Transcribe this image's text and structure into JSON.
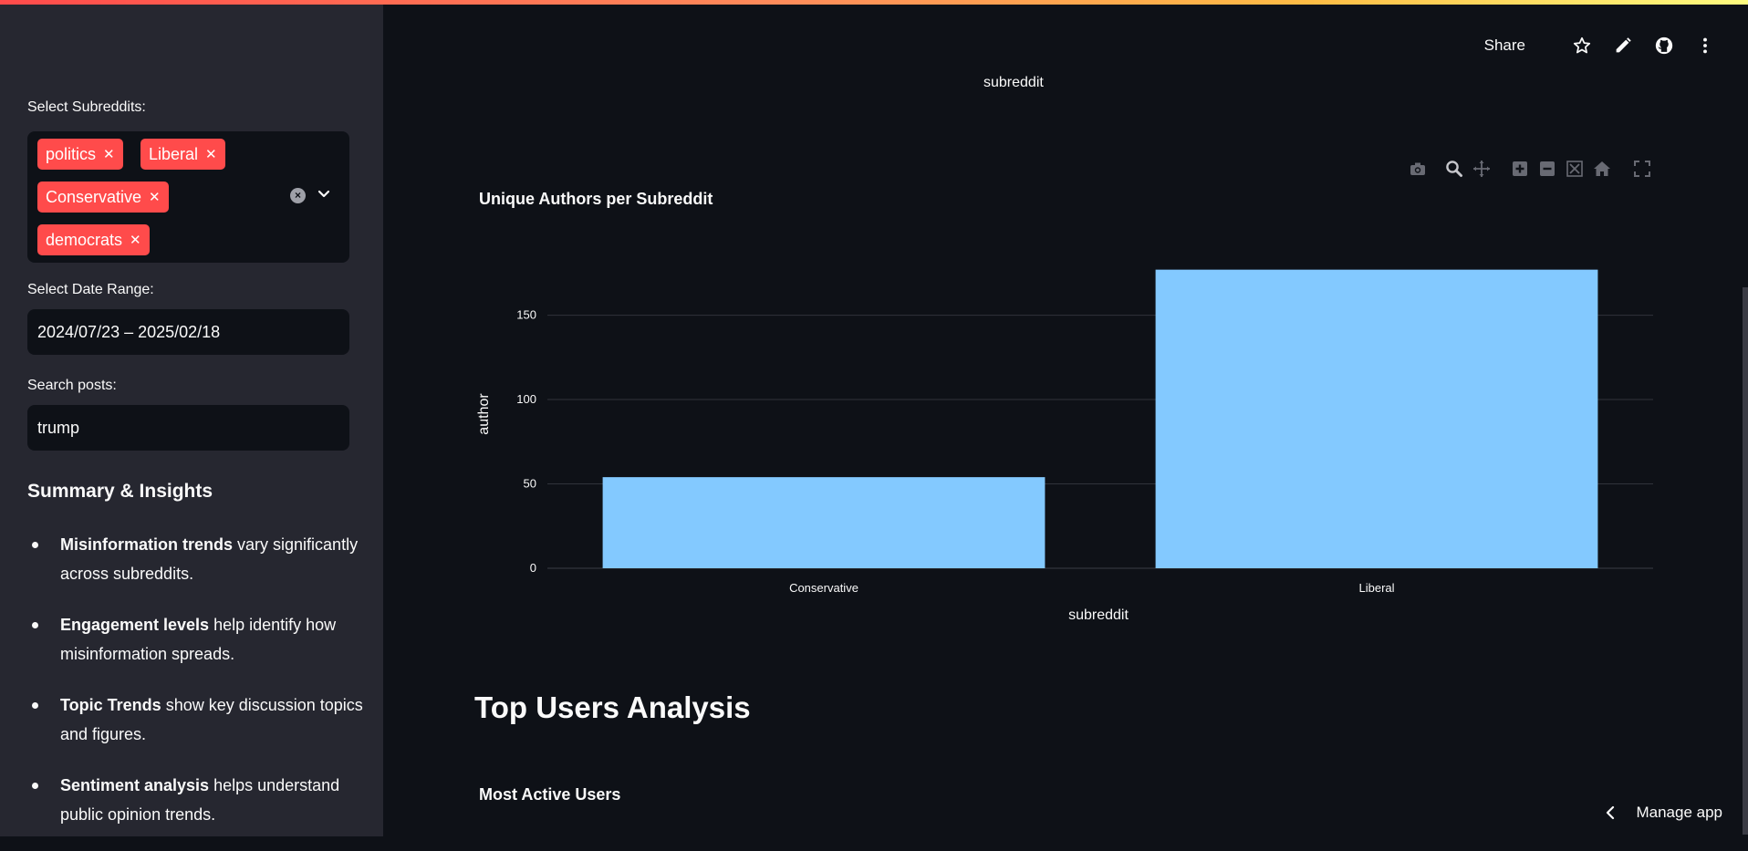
{
  "sidebar": {
    "subreddits_label": "Select Subreddits:",
    "chips": [
      {
        "label": "politics"
      },
      {
        "label": "Liberal"
      },
      {
        "label": "Conservative"
      },
      {
        "label": "democrats"
      }
    ],
    "chip_remove_glyph": "✕",
    "date_label": "Select Date Range:",
    "date_value": "2024/07/23 – 2025/02/18",
    "search_label": "Search posts:",
    "search_value": "trump",
    "summary_heading": "Summary & Insights",
    "insights": [
      {
        "bold": "Misinformation trends",
        "rest": " vary significantly across subreddits."
      },
      {
        "bold": "Engagement levels",
        "rest": " help identify how misinformation spreads."
      },
      {
        "bold": "Topic Trends",
        "rest": " show key discussion topics and figures."
      },
      {
        "bold": "Sentiment analysis",
        "rest": " helps understand public opinion trends."
      }
    ]
  },
  "header": {
    "share_label": "Share",
    "icons": [
      "star-icon",
      "pencil-icon",
      "github-icon",
      "more-vert-icon"
    ]
  },
  "main": {
    "prev_chart_axis_label": "subreddit",
    "modebar_icons": [
      "camera-icon",
      "zoom-icon",
      "pan-icon",
      "zoom-in-icon",
      "zoom-out-icon",
      "autoscale-icon",
      "reset-axes-icon",
      "fullscreen-icon"
    ],
    "chart_title": "Unique Authors per Subreddit",
    "section_heading": "Top Users Analysis",
    "sub_heading": "Most Active Users",
    "manage_app_label": "Manage app"
  },
  "colors": {
    "accent": "#ff4b4b",
    "bar": "#83c9ff",
    "background": "#0e1117",
    "sidebar": "#262730"
  },
  "chart_data": {
    "type": "bar",
    "title": "Unique Authors per Subreddit",
    "xlabel": "subreddit",
    "ylabel": "author",
    "categories": [
      "Conservative",
      "Liberal"
    ],
    "values": [
      54,
      177
    ],
    "yticks": [
      0,
      50,
      100,
      150
    ],
    "ylim": [
      0,
      186
    ],
    "grid": true
  }
}
